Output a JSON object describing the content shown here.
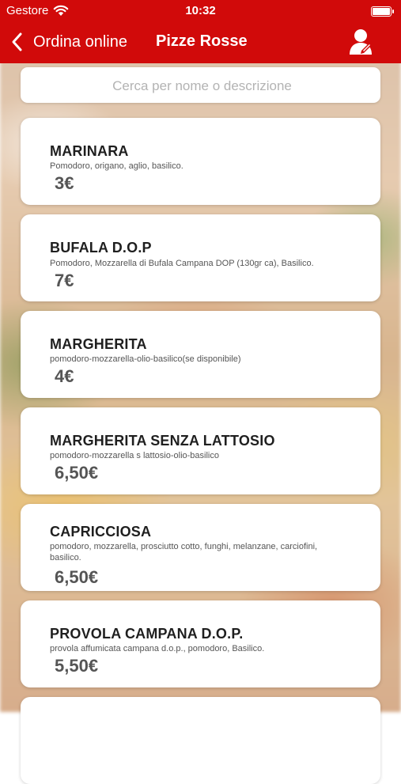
{
  "status_bar": {
    "carrier": "Gestore",
    "time": "10:32"
  },
  "nav": {
    "back_label": "Ordina online",
    "title": "Pizze Rosse"
  },
  "search": {
    "placeholder": "Cerca per nome o descrizione",
    "value": ""
  },
  "menu_items": [
    {
      "name": "MARINARA",
      "description": "Pomodoro, origano, aglio, basilico.",
      "price": "3€"
    },
    {
      "name": "BUFALA D.O.P",
      "description": "Pomodoro, Mozzarella di Bufala Campana DOP (130gr ca), Basilico.",
      "price": "7€"
    },
    {
      "name": "MARGHERITA",
      "description": "pomodoro-mozzarella-olio-basilico(se disponibile)",
      "price": "4€"
    },
    {
      "name": "MARGHERITA SENZA LATTOSIO",
      "description": "pomodoro-mozzarella s lattosio-olio-basilico",
      "price": "6,50€"
    },
    {
      "name": "CAPRICCIOSA",
      "description": "pomodoro, mozzarella, prosciutto cotto, funghi, melanzane, carciofini, basilico.",
      "price": "6,50€"
    },
    {
      "name": "PROVOLA CAMPANA D.O.P.",
      "description": "provola affumicata campana d.o.p., pomodoro, Basilico.",
      "price": "5,50€"
    }
  ]
}
